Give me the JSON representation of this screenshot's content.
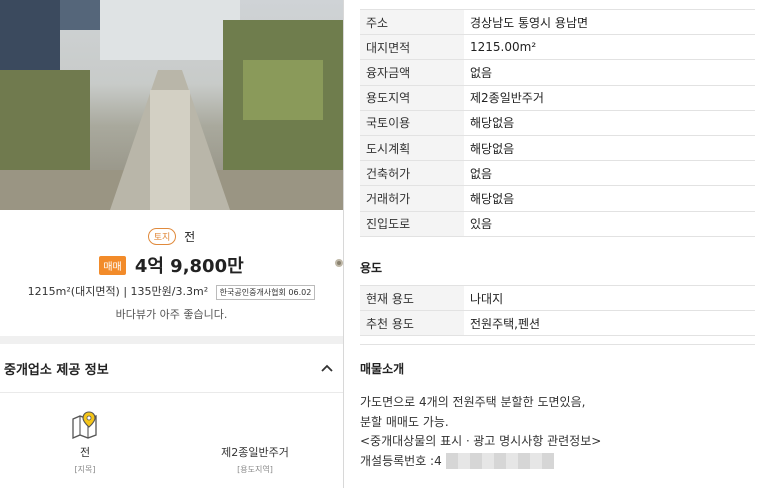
{
  "listing": {
    "type_badge": "토지",
    "type": "전",
    "deal_badge": "매매",
    "price": "4억 9,800만",
    "area_info": "1215m²(대지면적) | 135만원/3.3m²",
    "association_badge": "한국공인중개사협회 06.02",
    "description": "바다뷰가 아주 좋습니다."
  },
  "agent": {
    "title": "중개업소 제공 정보",
    "features": [
      {
        "value": "전",
        "label": "[지목]",
        "icon": "map-pin-icon"
      },
      {
        "value": "제2종일반주거",
        "label": "[용도지역]"
      }
    ]
  },
  "details": [
    {
      "key": "주소",
      "value": "경상남도 통영시 용남면"
    },
    {
      "key": "대지면적",
      "value": "1215.00m²"
    },
    {
      "key": "융자금액",
      "value": "없음"
    },
    {
      "key": "용도지역",
      "value": "제2종일반주거"
    },
    {
      "key": "국토이용",
      "value": "해당없음"
    },
    {
      "key": "도시계획",
      "value": "해당없음"
    },
    {
      "key": "건축허가",
      "value": "없음"
    },
    {
      "key": "거래허가",
      "value": "해당없음"
    },
    {
      "key": "진입도로",
      "value": "있음"
    }
  ],
  "usage": {
    "title": "용도",
    "rows": [
      {
        "key": "현재 용도",
        "value": "나대지"
      },
      {
        "key": "추천 용도",
        "value": "전원주택,펜션"
      }
    ]
  },
  "intro": {
    "title": "매물소개",
    "lines": [
      "가도면으로 4개의 전원주택 분할한 도면있음,",
      "분할 매매도 가능.",
      "<중개대상물의 표시ㆍ광고 명시사항 관련정보>"
    ],
    "reg_label": "개설등록번호 :4"
  }
}
